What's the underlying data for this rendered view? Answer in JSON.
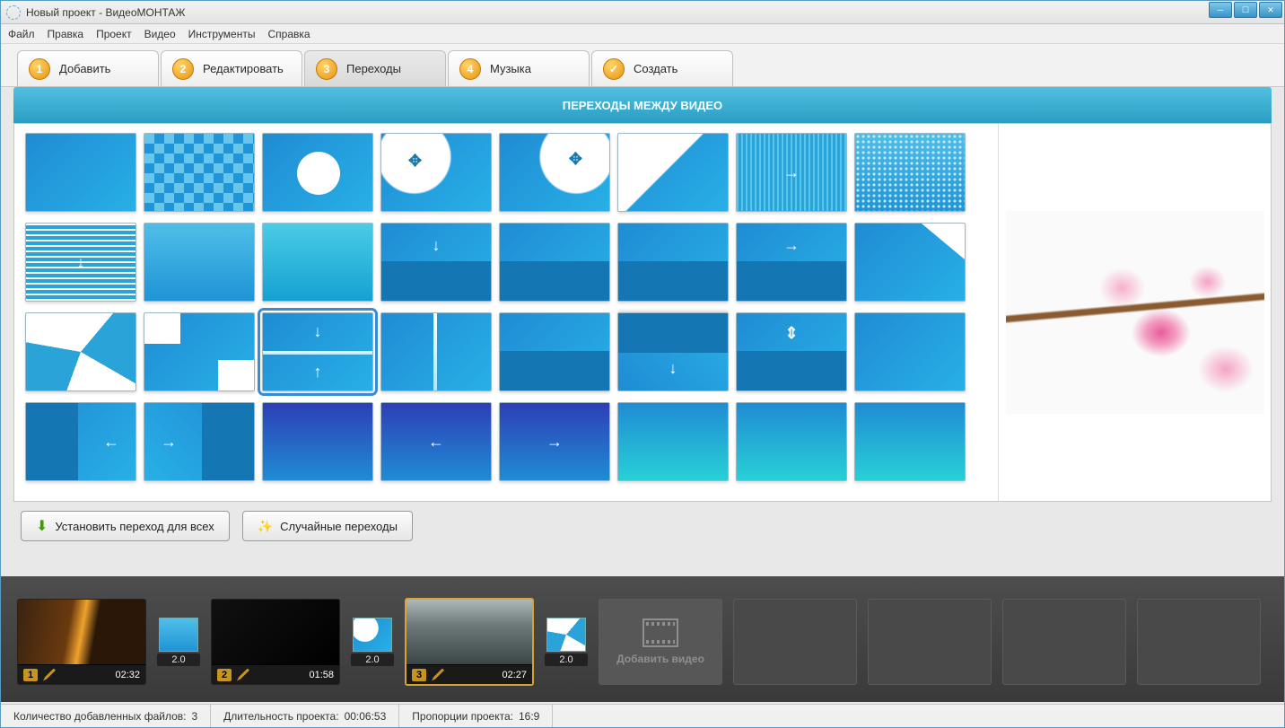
{
  "window": {
    "title": "Новый проект - ВидеоМОНТАЖ"
  },
  "menu": {
    "file": "Файл",
    "edit": "Правка",
    "project": "Проект",
    "video": "Видео",
    "tools": "Инструменты",
    "help": "Справка"
  },
  "steps": {
    "s1": {
      "num": "1",
      "label": "Добавить"
    },
    "s2": {
      "num": "2",
      "label": "Редактировать"
    },
    "s3": {
      "num": "3",
      "label": "Переходы"
    },
    "s4": {
      "num": "4",
      "label": "Музыка"
    },
    "s5": {
      "num": "✓",
      "label": "Создать"
    }
  },
  "banner": "ПЕРЕХОДЫ МЕЖДУ ВИДЕО",
  "buttons": {
    "apply_all": "Установить переход для всех",
    "random": "Случайные переходы"
  },
  "timeline": {
    "clips": [
      {
        "num": "1",
        "dur": "02:32"
      },
      {
        "num": "2",
        "dur": "01:58"
      },
      {
        "num": "3",
        "dur": "02:27"
      }
    ],
    "trans_dur": "2.0",
    "add_label": "Добавить видео"
  },
  "status": {
    "files_label": "Количество добавленных файлов:",
    "files_val": "3",
    "duration_label": "Длительность проекта:",
    "duration_val": "00:06:53",
    "aspect_label": "Пропорции проекта:",
    "aspect_val": "16:9"
  }
}
